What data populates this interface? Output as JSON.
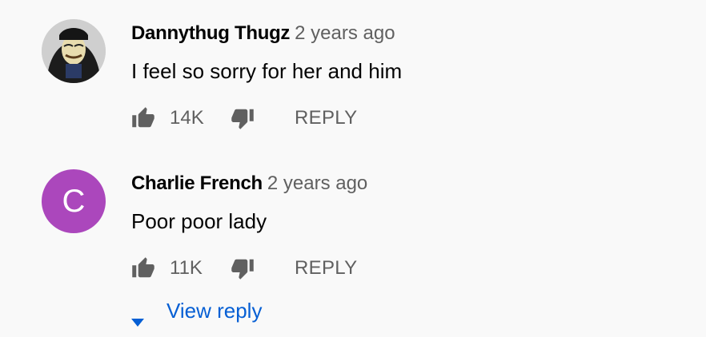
{
  "comments": [
    {
      "author": "Dannythug Thugz",
      "time": "2 years ago",
      "text": "I feel so sorry for her and him",
      "likes": "14K",
      "reply_label": "REPLY",
      "avatar_type": "photo"
    },
    {
      "author": "Charlie French",
      "time": "2 years ago",
      "text": "Poor poor lady",
      "likes": "11K",
      "reply_label": "REPLY",
      "avatar_type": "letter",
      "avatar_letter": "C",
      "avatar_color": "#ab47bc"
    }
  ],
  "view_reply_label": "View reply",
  "colors": {
    "background": "#f9f9f9",
    "secondary_text": "#606060",
    "link_blue": "#065fd4"
  },
  "icons": [
    "thumb-up-icon",
    "thumb-down-icon",
    "caret-down-icon"
  ]
}
